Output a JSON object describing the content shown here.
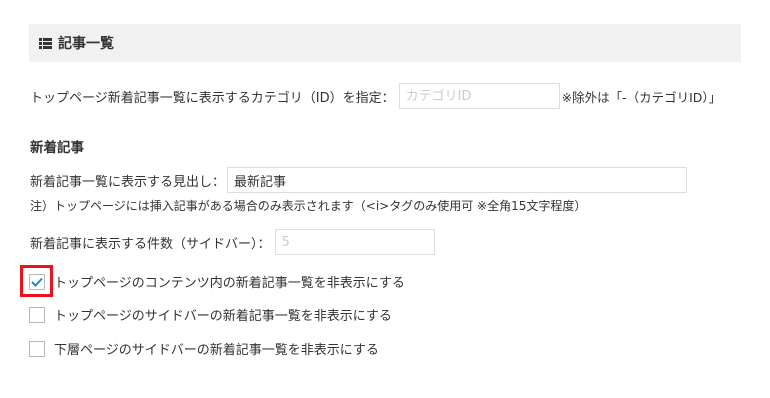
{
  "section": {
    "icon": "list-icon",
    "title": "記事一覧"
  },
  "category_setting": {
    "label": "トップページ新着記事一覧に表示するカテゴリ（ID）を指定：",
    "value": "",
    "placeholder": "カテゴリID",
    "suffix": "※除外は「-（カテゴリID）」"
  },
  "new_posts": {
    "heading": "新着記事",
    "headline_label": "新着記事一覧に表示する見出し：",
    "headline_value": "最新記事",
    "note": "注）トップページには挿入記事がある場合のみ表示されます（<i>タグのみ使用可 ※全角15文字程度）",
    "count_label": "新着記事に表示する件数（サイドバー）：",
    "count_value": "",
    "count_placeholder": "5"
  },
  "checkboxes": [
    {
      "label": "トップページのコンテンツ内の新着記事一覧を非表示にする",
      "checked": true
    },
    {
      "label": "トップページのサイドバーの新着記事一覧を非表示にする",
      "checked": false
    },
    {
      "label": "下層ページのサイドバーの新着記事一覧を非表示にする",
      "checked": false
    }
  ],
  "colors": {
    "highlight": "#e8141d",
    "checkmark": "#1e8cbe"
  }
}
